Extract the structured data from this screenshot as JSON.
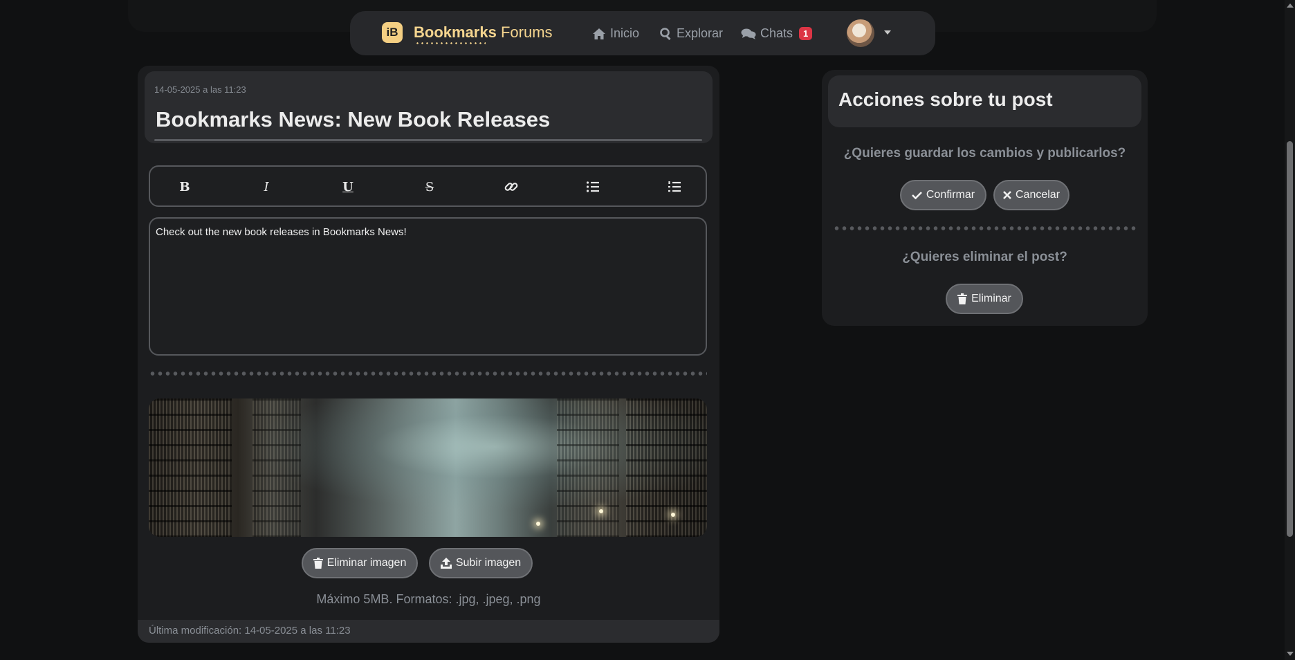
{
  "navbar": {
    "brand_bold": "Bookmarks",
    "brand_light": "Forums",
    "brand_logo_letter": "iB",
    "items": [
      {
        "label": "Inicio",
        "icon": "home-icon"
      },
      {
        "label": "Explorar",
        "icon": "search-icon"
      },
      {
        "label": "Chats",
        "icon": "chats-icon",
        "badge": "1"
      }
    ]
  },
  "post": {
    "date": "14-05-2025 a las 11:23",
    "title": "Bookmarks News: New Book Releases",
    "body": "Check out the new book releases in Bookmarks News!",
    "toolbar": [
      "bold-icon",
      "italic-icon",
      "underline-icon",
      "strikethrough-icon",
      "link-icon",
      "bullet-list-icon",
      "numbered-list-icon"
    ],
    "remove_image_label": "Eliminar imagen",
    "upload_image_label": "Subir imagen",
    "image_hint": "Máximo 5MB. Formatos: .jpg, .jpeg, .png",
    "footer": "Última modificación: 14-05-2025 a las 11:23"
  },
  "actions": {
    "title": "Acciones sobre tu post",
    "save_question": "¿Quieres guardar los cambios y publicarlos?",
    "confirm_label": "Confirmar",
    "cancel_label": "Cancelar",
    "delete_question": "¿Quieres eliminar el post?",
    "delete_label": "Eliminar"
  },
  "colors": {
    "background": "#101112",
    "card": "#1c1d1f",
    "brand": "#f5d58f",
    "badge": "#dc3545",
    "button": "#54565a"
  }
}
